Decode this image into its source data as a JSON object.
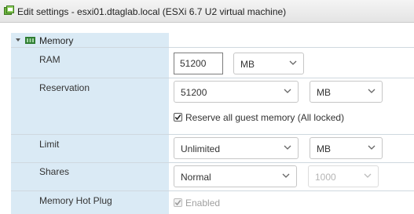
{
  "window": {
    "title": "Edit settings - esxi01.dtaglab.local (ESXi 6.7 U2 virtual machine)",
    "icon": "vm-settings-icon"
  },
  "memory": {
    "section_label": "Memory",
    "expanded": true,
    "ram": {
      "label": "RAM",
      "value": "51200",
      "unit": "MB"
    },
    "reservation": {
      "label": "Reservation",
      "value": "51200",
      "unit": "MB",
      "reserve_all_label": "Reserve all guest memory (All locked)",
      "reserve_all_checked": true
    },
    "limit": {
      "label": "Limit",
      "value": "Unlimited",
      "unit": "MB"
    },
    "shares": {
      "label": "Shares",
      "value": "Normal",
      "count": "1000",
      "count_disabled": true
    },
    "hot_plug": {
      "label": "Memory Hot Plug",
      "enabled_label": "Enabled",
      "checked": true,
      "disabled": true
    }
  },
  "colors": {
    "left_column_bg": "#daeaf5",
    "titlebar_bg": "#e9e9e9"
  }
}
